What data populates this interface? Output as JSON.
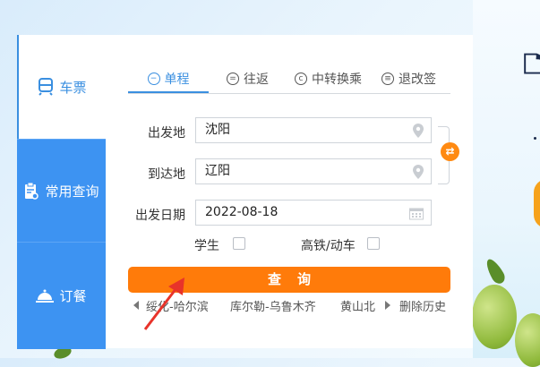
{
  "sidebar": {
    "items": [
      {
        "label": "车票",
        "icon": "train-icon",
        "active": true
      },
      {
        "label": "常用查询",
        "icon": "clipboard-search-icon",
        "active": false
      },
      {
        "label": "订餐",
        "icon": "food-cloche-icon",
        "active": false
      }
    ]
  },
  "tabs": [
    {
      "label": "单程",
      "icon": "minus-circle-icon",
      "active": true
    },
    {
      "label": "往返",
      "icon": "equals-circle-icon",
      "active": false
    },
    {
      "label": "中转换乘",
      "icon": "transfer-circle-icon",
      "active": false
    },
    {
      "label": "退改签",
      "icon": "refund-circle-icon",
      "active": false
    }
  ],
  "form": {
    "from_label": "出发地",
    "from_value": "沈阳",
    "to_label": "到达地",
    "to_value": "辽阳",
    "date_label": "出发日期",
    "date_value": "2022-08-18",
    "student_label": "学生",
    "gaotie_label": "高铁/动车",
    "swap_icon": "⇄"
  },
  "search_button": "查询",
  "history": {
    "items": [
      "绥化-哈尔滨",
      "库尔勒-乌鲁木齐",
      "黄山北"
    ],
    "clear_label": "删除历史"
  },
  "colors": {
    "accent_blue": "#3a8fe0",
    "sidebar_blue": "#3d93f2",
    "orange": "#ff7b0a"
  }
}
